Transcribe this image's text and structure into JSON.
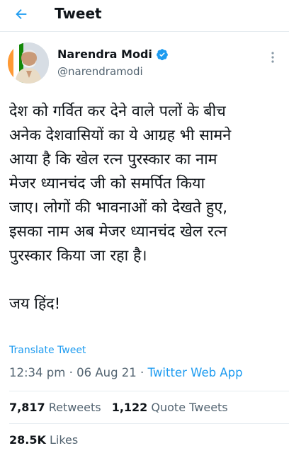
{
  "header": {
    "title": "Tweet",
    "back_icon": "back-arrow-icon",
    "accent_color": "#1d9bf0"
  },
  "author": {
    "name": "Narendra Modi",
    "handle": "@narendramodi",
    "verified_icon": "verified-badge-icon",
    "more_icon": "more-options-icon"
  },
  "tweet": {
    "text": "देश को गर्वित कर देने वाले पलों के बीच\nअनेक देशवासियों का ये आग्रह भी सामने\nआया है कि खेल रत्न पुरस्कार का नाम\nमेजर ध्यानचंद जी को समर्पित किया\nजाए। लोगों की भावनाओं को देखते हुए,\nइसका नाम अब मेजर ध्यानचंद खेल रत्न\nपुरस्कार किया जा रहा है।\n\nजय हिंद!",
    "translate_label": "Translate Tweet",
    "time": "12:34 pm",
    "separator": "·",
    "date": "06 Aug 21",
    "source": "Twitter Web App"
  },
  "stats": {
    "retweets_count": "7,817",
    "retweets_label": "Retweets",
    "quotes_count": "1,122",
    "quotes_label": "Quote Tweets",
    "likes_count": "28.5K",
    "likes_label": "Likes"
  }
}
